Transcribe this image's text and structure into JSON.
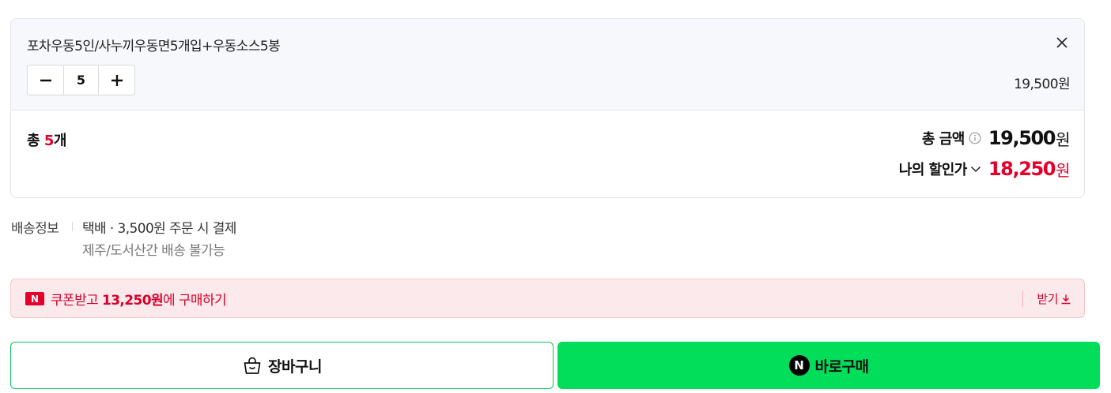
{
  "option": {
    "name": "포차우동5인/사누끼우동면5개입+우동소스5봉",
    "quantity": "5",
    "price": "19,500원"
  },
  "summary": {
    "total_prefix": "총 ",
    "total_count": "5",
    "total_suffix": "개",
    "total_amount_label": "총 금액",
    "total_amount": "19,500",
    "total_amount_unit": "원",
    "discount_label": "나의 할인가",
    "discount_amount": "18,250",
    "discount_unit": "원"
  },
  "delivery": {
    "title": "배송정보",
    "line1": "택배 · 3,500원 주문 시 결제",
    "line2": "제주/도서산간 배송 불가능"
  },
  "coupon": {
    "badge": "N",
    "text_prefix": "쿠폰받고 ",
    "amount": "13,250원",
    "text_suffix": "에 구매하기",
    "receive_label": "받기"
  },
  "actions": {
    "cart_label": "장바구니",
    "buy_badge": "N",
    "buy_label": "바로구매"
  },
  "colors": {
    "accent_red": "#e4002b",
    "naver_green": "#03de5a",
    "coupon_bg": "#fbe9ec"
  },
  "icons": [
    "close-icon",
    "minus-icon",
    "plus-icon",
    "info-icon",
    "chevron-down-icon",
    "download-icon",
    "shopping-bag-icon",
    "naver-n-icon"
  ]
}
